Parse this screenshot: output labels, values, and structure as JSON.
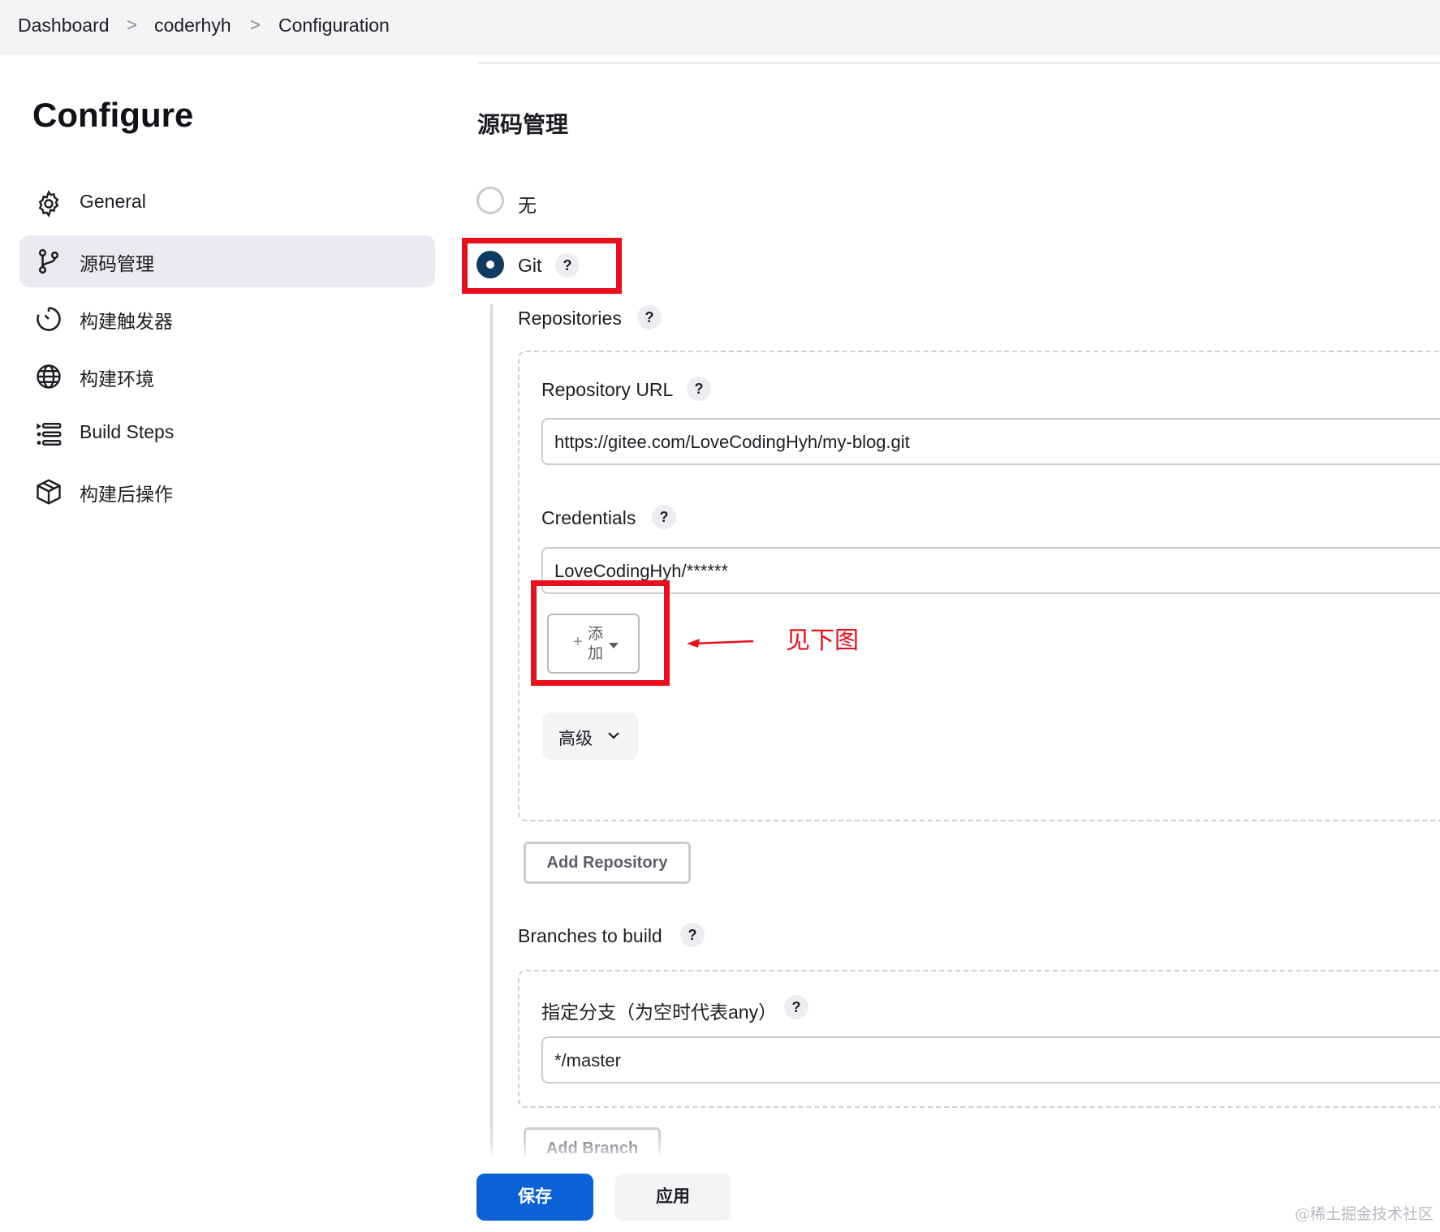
{
  "breadcrumb": {
    "items": [
      "Dashboard",
      "coderhyh",
      "Configuration"
    ],
    "separator": ">"
  },
  "sidebar": {
    "title": "Configure",
    "items": [
      {
        "label": "General",
        "icon": "gear-icon"
      },
      {
        "label": "源码管理",
        "icon": "git-branch-icon",
        "active": true
      },
      {
        "label": "构建触发器",
        "icon": "clock-icon"
      },
      {
        "label": "构建环境",
        "icon": "globe-icon"
      },
      {
        "label": "Build Steps",
        "icon": "list-icon"
      },
      {
        "label": "构建后操作",
        "icon": "package-icon"
      }
    ]
  },
  "scm": {
    "section_title": "源码管理",
    "option_none": "无",
    "option_git": "Git",
    "selected": "Git",
    "help": "?",
    "repositories_label": "Repositories",
    "repo_url_label": "Repository URL",
    "repo_url_value": "https://gitee.com/LoveCodingHyh/my-blog.git",
    "credentials_label": "Credentials",
    "credentials_value": "LoveCodingHyh/******",
    "add_button_plus": "+",
    "add_button_label": "添加",
    "advanced_label": "高级",
    "add_repository_label": "Add Repository",
    "branches_label": "Branches to build",
    "branch_specifier_label": "指定分支（为空时代表any）",
    "branch_value": "*/master",
    "add_branch_label": "Add Branch"
  },
  "annotation": {
    "text": "见下图",
    "color": "#e8101c"
  },
  "footer": {
    "save_label": "保存",
    "apply_label": "应用"
  },
  "watermark": "@稀土掘金技术社区",
  "colors": {
    "primary": "#0b62d6",
    "radio_selected": "#0f3b63",
    "highlight_red": "#e8101c"
  }
}
